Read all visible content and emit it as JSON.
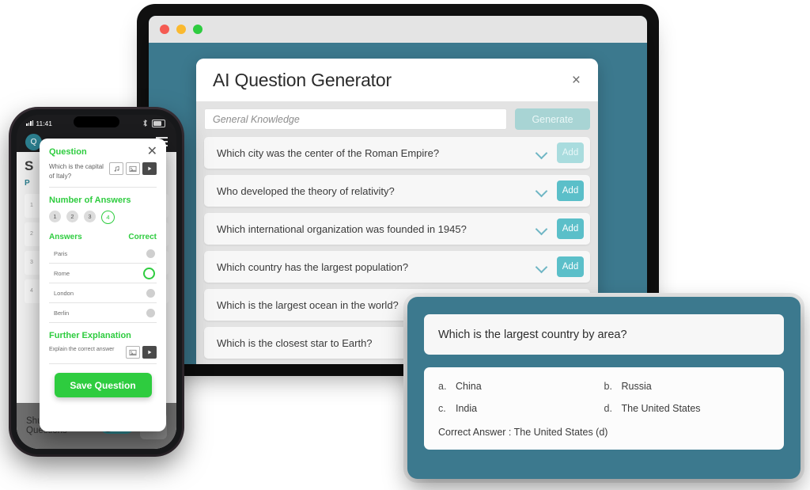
{
  "browser": {
    "traffic_lights": [
      "close",
      "minimize",
      "maximize"
    ],
    "colors": {
      "close": "#F55B52",
      "minimize": "#FAB92F",
      "maximize": "#2ECC40",
      "body": "#3C798E"
    }
  },
  "generator": {
    "title": "AI Question Generator",
    "close_label": "×",
    "topic_input": {
      "value": "",
      "placeholder": "General Knowledge"
    },
    "generate_label": "Generate",
    "add_label": "Add",
    "questions": [
      {
        "text": "Which city was the center of the Roman Empire?",
        "add_state": "faded"
      },
      {
        "text": "Who developed the theory of relativity?",
        "add_state": "active"
      },
      {
        "text": "Which international organization was founded in 1945?",
        "add_state": "active"
      },
      {
        "text": "Which country has the largest population?",
        "add_state": "active"
      },
      {
        "text": "Which is the largest ocean in the world?",
        "add_state": "active"
      },
      {
        "text": "Which is the closest star to Earth?",
        "add_state": "active"
      }
    ]
  },
  "phone": {
    "status": {
      "time": "11:41",
      "battery_icon": "battery-icon",
      "signal_icon": "signal-icon"
    },
    "logo_letter": "Q",
    "background": {
      "title": "S",
      "subtitle": "P",
      "items": [
        "1",
        "2",
        "3",
        "4"
      ]
    },
    "modal": {
      "close_label": "✕",
      "question_heading": "Question",
      "question_text": "Which is the capital of Italy?",
      "media_icons": [
        "music-icon",
        "image-icon",
        "video-icon"
      ],
      "answers_count_heading": "Number of Answers",
      "answer_counts": [
        "1",
        "2",
        "3",
        "4"
      ],
      "selected_count": "4",
      "answers_heading": "Answers",
      "correct_heading": "Correct",
      "answers": [
        {
          "label": "Paris",
          "correct": false
        },
        {
          "label": "Rome",
          "correct": true
        },
        {
          "label": "London",
          "correct": false
        },
        {
          "label": "Berlin",
          "correct": false
        }
      ],
      "explanation_heading": "Further Explanation",
      "explanation_text": "Explain the correct answer",
      "explanation_icons": [
        "image-icon",
        "video-icon"
      ],
      "save_label": "Save Question"
    },
    "footer": {
      "shuffle_label": "Shuffle Questions",
      "shuffle_state": "OFF",
      "collapse_icon": "chevron-up-icon"
    }
  },
  "answer_card": {
    "question": "Which is the largest country by area?",
    "options": [
      {
        "key": "a.",
        "text": "China"
      },
      {
        "key": "b.",
        "text": "Russia"
      },
      {
        "key": "c.",
        "text": "India"
      },
      {
        "key": "d.",
        "text": "The United States"
      }
    ],
    "correct_answer": "Correct Answer : The United States (d)"
  }
}
